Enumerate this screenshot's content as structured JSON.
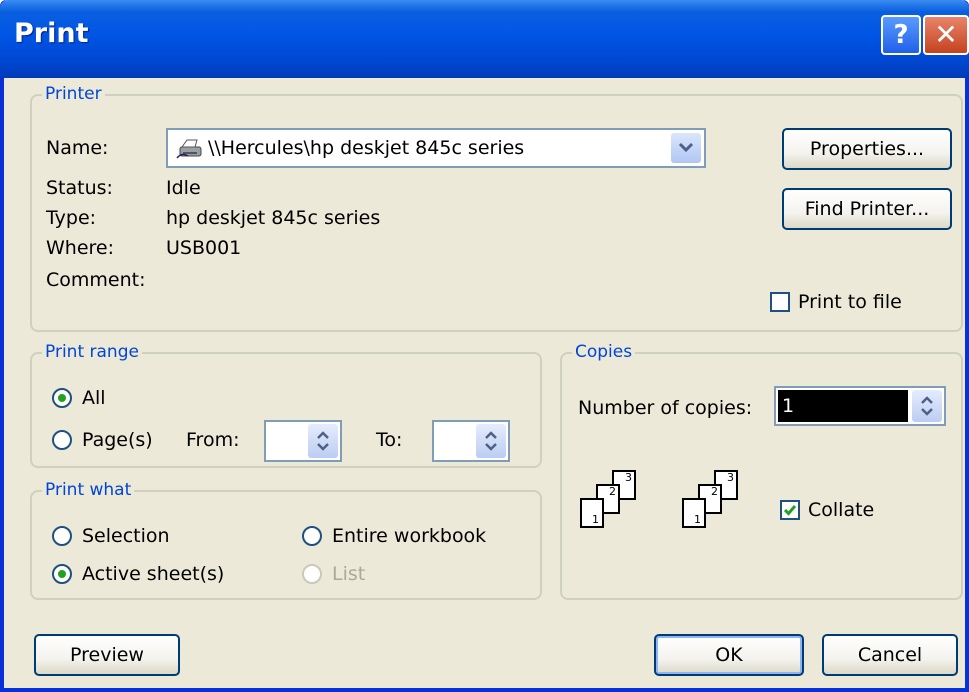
{
  "window": {
    "title": "Print",
    "help_label": "?",
    "close_label": "✕"
  },
  "printer": {
    "legend": "Printer",
    "name_label": "Name:",
    "name_value": "\\\\Hercules\\hp deskjet 845c series",
    "status_label": "Status:",
    "status_value": "Idle",
    "type_label": "Type:",
    "type_value": "hp deskjet 845c series",
    "where_label": "Where:",
    "where_value": "USB001",
    "comment_label": "Comment:",
    "properties_label": "Properties...",
    "find_printer_label": "Find Printer...",
    "print_to_file_label": "Print to file"
  },
  "print_range": {
    "legend": "Print range",
    "all_label": "All",
    "pages_label": "Page(s)",
    "from_label": "From:",
    "to_label": "To:"
  },
  "print_what": {
    "legend": "Print what",
    "selection_label": "Selection",
    "entire_workbook_label": "Entire workbook",
    "active_sheets_label": "Active sheet(s)",
    "list_label": "List"
  },
  "copies": {
    "legend": "Copies",
    "number_label": "Number of copies:",
    "number_value": "1",
    "collate_label": "Collate",
    "collate_checked": true
  },
  "footer": {
    "preview_label": "Preview",
    "ok_label": "OK",
    "cancel_label": "Cancel"
  },
  "colors": {
    "accent": "#0046d5",
    "titlebar": "#0055e5",
    "face": "#ece9d8"
  }
}
